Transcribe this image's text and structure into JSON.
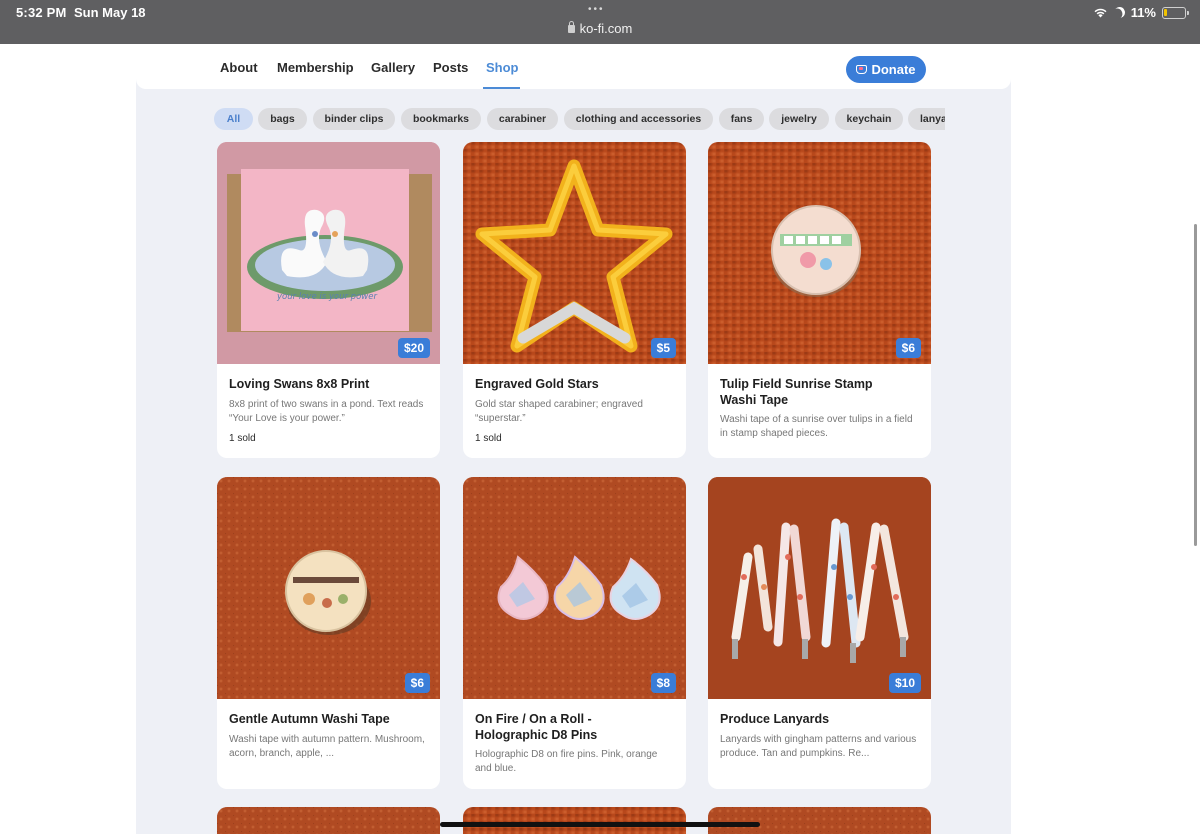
{
  "status_bar": {
    "time": "5:32 PM",
    "date": "Sun May 18",
    "battery": "11%",
    "url": "ko-fi.com"
  },
  "nav": {
    "links": [
      "About",
      "Membership",
      "Gallery",
      "Posts",
      "Shop"
    ],
    "active": "Shop",
    "donate_label": "Donate"
  },
  "filters": [
    "All",
    "bags",
    "binder clips",
    "bookmarks",
    "carabiner",
    "clothing and accessories",
    "fans",
    "jewelry",
    "keychain",
    "lanya"
  ],
  "active_filter": "All",
  "products": [
    {
      "title": "Loving Swans 8x8 Print",
      "price": "$20",
      "desc": "8x8 print of two swans in a pond. Text reads “Your Love is your power.”",
      "sold": "1 sold",
      "image_text": "your love is your power"
    },
    {
      "title": "Engraved Gold Stars",
      "price": "$5",
      "desc": "Gold star shaped carabiner; engraved “superstar.”",
      "sold": "1 sold"
    },
    {
      "title": "Tulip Field Sunrise Stamp Washi Tape",
      "price": "$6",
      "desc": "Washi tape of a sunrise over tulips in a field in stamp shaped pieces."
    },
    {
      "title": "Gentle Autumn Washi Tape",
      "price": "$6",
      "desc": "Washi tape with autumn pattern. Mushroom, acorn, branch, apple, ..."
    },
    {
      "title": "On Fire / On a Roll - Holographic D8 Pins",
      "price": "$8",
      "desc": "Holographic D8 on fire pins. Pink, orange and blue."
    },
    {
      "title": "Produce Lanyards",
      "price": "$10",
      "desc": "Lanyards with gingham patterns and various produce. Tan and pumpkins. Re..."
    }
  ],
  "colors": {
    "accent": "#3a7dd8",
    "page_bg": "#eef0f6",
    "topbar": "#5f5f61",
    "knit": "#b8481b"
  }
}
